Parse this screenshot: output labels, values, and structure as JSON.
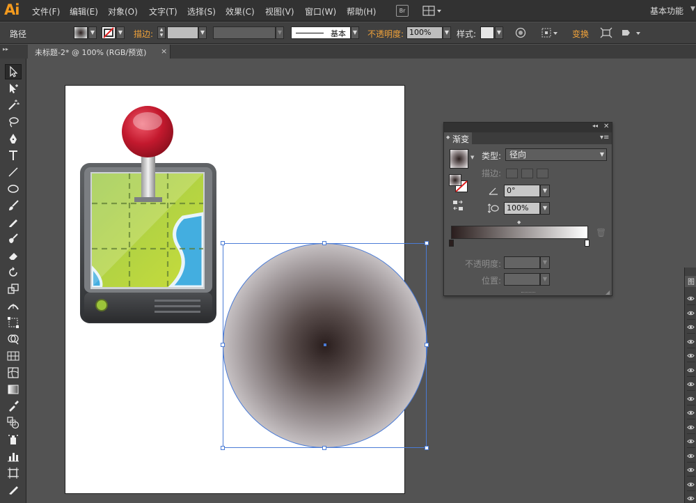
{
  "app": {
    "logo": "Ai"
  },
  "menubar": {
    "items": [
      "文件(F)",
      "编辑(E)",
      "对象(O)",
      "文字(T)",
      "选择(S)",
      "效果(C)",
      "视图(V)",
      "窗口(W)",
      "帮助(H)"
    ],
    "bridge_label": "Br",
    "workspace": "基本功能"
  },
  "controlbar": {
    "selection_type": "路径",
    "stroke_label": "描边:",
    "stroke_style_label": "基本",
    "opacity_label": "不透明度:",
    "opacity_value": "100%",
    "style_label": "样式:",
    "transform_label": "变换"
  },
  "document": {
    "tab_title": "未标题-2* @ 100% (RGB/预览)",
    "close_glyph": "×"
  },
  "tools": [
    "selection-tool",
    "direct-selection-tool",
    "magic-wand-tool",
    "lasso-tool",
    "pen-tool",
    "type-tool",
    "line-segment-tool",
    "ellipse-tool",
    "paintbrush-tool",
    "pencil-tool",
    "blob-brush-tool",
    "eraser-tool",
    "rotate-tool",
    "scale-tool",
    "width-tool",
    "free-transform-tool",
    "shape-builder-tool",
    "perspective-grid-tool",
    "mesh-tool",
    "gradient-tool",
    "eyedropper-tool",
    "blend-tool",
    "symbol-sprayer-tool",
    "column-graph-tool",
    "artboard-tool",
    "slice-tool",
    "hand-tool"
  ],
  "gradient_panel": {
    "tab_label": "渐变",
    "type_label": "类型:",
    "type_value": "径向",
    "stroke_label": "描边:",
    "angle_value": "0°",
    "aspect_value": "100%",
    "opacity_label": "不透明度:",
    "location_label": "位置:",
    "start_color": "#2a1e1d",
    "end_color": "#ffffff"
  },
  "colors": {
    "accent": "#f39a1e",
    "selection": "#4a7bd6"
  }
}
